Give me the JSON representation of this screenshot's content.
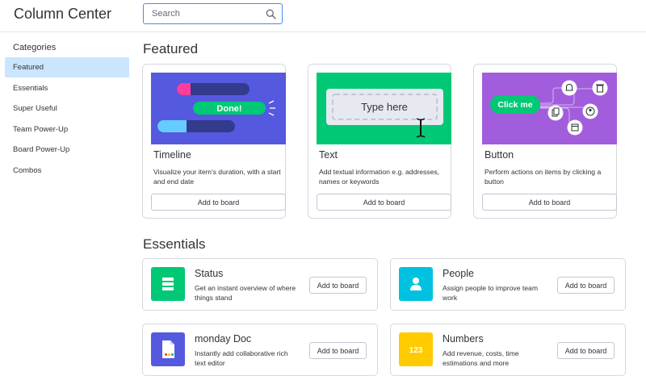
{
  "header": {
    "title": "Column Center",
    "search_placeholder": "Search"
  },
  "sidebar": {
    "heading": "Categories",
    "items": [
      {
        "label": "Featured",
        "active": true
      },
      {
        "label": "Essentials",
        "active": false
      },
      {
        "label": "Super Useful",
        "active": false
      },
      {
        "label": "Team Power-Up",
        "active": false
      },
      {
        "label": "Board Power-Up",
        "active": false
      },
      {
        "label": "Combos",
        "active": false
      }
    ]
  },
  "featured": {
    "title": "Featured",
    "cards": [
      {
        "name": "Timeline",
        "description": "Visualize your item's duration, with a start and end date",
        "button": "Add to board",
        "image_text": "Done!",
        "bg": "#5559df"
      },
      {
        "name": "Text",
        "description": "Add textual information e.g. addresses, names or keywords",
        "button": "Add to board",
        "image_text": "Type here",
        "bg": "#00c875"
      },
      {
        "name": "Button",
        "description": "Perform actions on items by clicking a button",
        "button": "Add to board",
        "image_text": "Click me",
        "bg": "#a25ddc"
      }
    ]
  },
  "essentials": {
    "title": "Essentials",
    "cards": [
      {
        "name": "Status",
        "description": "Get an instant overview of where things stand",
        "button": "Add to board",
        "icon": "status-icon",
        "color": "#00c875"
      },
      {
        "name": "People",
        "description": "Assign people to improve team work",
        "button": "Add to board",
        "icon": "person-icon",
        "color": "#00c2e0"
      },
      {
        "name": "monday Doc",
        "description": "Instantly add collaborative rich text editor",
        "button": "Add to board",
        "icon": "doc-icon",
        "color": "#5559df"
      },
      {
        "name": "Numbers",
        "description": "Add revenue, costs, time estimations and more",
        "button": "Add to board",
        "icon": "numbers-icon",
        "color": "#ffcb00",
        "icon_text": "123"
      }
    ]
  }
}
